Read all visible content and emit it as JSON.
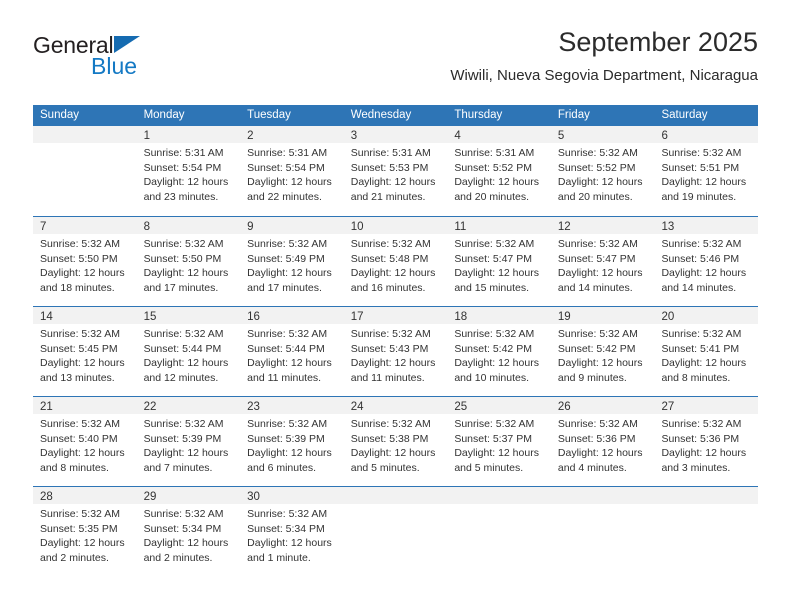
{
  "brand": {
    "name_part1": "General",
    "name_part2": "Blue",
    "triangle_color": "#156bb1",
    "blue_color": "#1479c4"
  },
  "header": {
    "title": "September 2025",
    "subtitle": "Wiwili, Nueva Segovia Department, Nicaragua"
  },
  "theme": {
    "header_blue": "#2e75b6",
    "daynum_band": "#f2f2f2",
    "text": "#333333"
  },
  "weekdays": [
    "Sunday",
    "Monday",
    "Tuesday",
    "Wednesday",
    "Thursday",
    "Friday",
    "Saturday"
  ],
  "weeks": [
    [
      {
        "day": "",
        "sunrise": "",
        "sunset": "",
        "daylight": "",
        "empty": true
      },
      {
        "day": "1",
        "sunrise": "Sunrise: 5:31 AM",
        "sunset": "Sunset: 5:54 PM",
        "daylight": "Daylight: 12 hours and 23 minutes."
      },
      {
        "day": "2",
        "sunrise": "Sunrise: 5:31 AM",
        "sunset": "Sunset: 5:54 PM",
        "daylight": "Daylight: 12 hours and 22 minutes."
      },
      {
        "day": "3",
        "sunrise": "Sunrise: 5:31 AM",
        "sunset": "Sunset: 5:53 PM",
        "daylight": "Daylight: 12 hours and 21 minutes."
      },
      {
        "day": "4",
        "sunrise": "Sunrise: 5:31 AM",
        "sunset": "Sunset: 5:52 PM",
        "daylight": "Daylight: 12 hours and 20 minutes."
      },
      {
        "day": "5",
        "sunrise": "Sunrise: 5:32 AM",
        "sunset": "Sunset: 5:52 PM",
        "daylight": "Daylight: 12 hours and 20 minutes."
      },
      {
        "day": "6",
        "sunrise": "Sunrise: 5:32 AM",
        "sunset": "Sunset: 5:51 PM",
        "daylight": "Daylight: 12 hours and 19 minutes."
      }
    ],
    [
      {
        "day": "7",
        "sunrise": "Sunrise: 5:32 AM",
        "sunset": "Sunset: 5:50 PM",
        "daylight": "Daylight: 12 hours and 18 minutes."
      },
      {
        "day": "8",
        "sunrise": "Sunrise: 5:32 AM",
        "sunset": "Sunset: 5:50 PM",
        "daylight": "Daylight: 12 hours and 17 minutes."
      },
      {
        "day": "9",
        "sunrise": "Sunrise: 5:32 AM",
        "sunset": "Sunset: 5:49 PM",
        "daylight": "Daylight: 12 hours and 17 minutes."
      },
      {
        "day": "10",
        "sunrise": "Sunrise: 5:32 AM",
        "sunset": "Sunset: 5:48 PM",
        "daylight": "Daylight: 12 hours and 16 minutes."
      },
      {
        "day": "11",
        "sunrise": "Sunrise: 5:32 AM",
        "sunset": "Sunset: 5:47 PM",
        "daylight": "Daylight: 12 hours and 15 minutes."
      },
      {
        "day": "12",
        "sunrise": "Sunrise: 5:32 AM",
        "sunset": "Sunset: 5:47 PM",
        "daylight": "Daylight: 12 hours and 14 minutes."
      },
      {
        "day": "13",
        "sunrise": "Sunrise: 5:32 AM",
        "sunset": "Sunset: 5:46 PM",
        "daylight": "Daylight: 12 hours and 14 minutes."
      }
    ],
    [
      {
        "day": "14",
        "sunrise": "Sunrise: 5:32 AM",
        "sunset": "Sunset: 5:45 PM",
        "daylight": "Daylight: 12 hours and 13 minutes."
      },
      {
        "day": "15",
        "sunrise": "Sunrise: 5:32 AM",
        "sunset": "Sunset: 5:44 PM",
        "daylight": "Daylight: 12 hours and 12 minutes."
      },
      {
        "day": "16",
        "sunrise": "Sunrise: 5:32 AM",
        "sunset": "Sunset: 5:44 PM",
        "daylight": "Daylight: 12 hours and 11 minutes."
      },
      {
        "day": "17",
        "sunrise": "Sunrise: 5:32 AM",
        "sunset": "Sunset: 5:43 PM",
        "daylight": "Daylight: 12 hours and 11 minutes."
      },
      {
        "day": "18",
        "sunrise": "Sunrise: 5:32 AM",
        "sunset": "Sunset: 5:42 PM",
        "daylight": "Daylight: 12 hours and 10 minutes."
      },
      {
        "day": "19",
        "sunrise": "Sunrise: 5:32 AM",
        "sunset": "Sunset: 5:42 PM",
        "daylight": "Daylight: 12 hours and 9 minutes."
      },
      {
        "day": "20",
        "sunrise": "Sunrise: 5:32 AM",
        "sunset": "Sunset: 5:41 PM",
        "daylight": "Daylight: 12 hours and 8 minutes."
      }
    ],
    [
      {
        "day": "21",
        "sunrise": "Sunrise: 5:32 AM",
        "sunset": "Sunset: 5:40 PM",
        "daylight": "Daylight: 12 hours and 8 minutes."
      },
      {
        "day": "22",
        "sunrise": "Sunrise: 5:32 AM",
        "sunset": "Sunset: 5:39 PM",
        "daylight": "Daylight: 12 hours and 7 minutes."
      },
      {
        "day": "23",
        "sunrise": "Sunrise: 5:32 AM",
        "sunset": "Sunset: 5:39 PM",
        "daylight": "Daylight: 12 hours and 6 minutes."
      },
      {
        "day": "24",
        "sunrise": "Sunrise: 5:32 AM",
        "sunset": "Sunset: 5:38 PM",
        "daylight": "Daylight: 12 hours and 5 minutes."
      },
      {
        "day": "25",
        "sunrise": "Sunrise: 5:32 AM",
        "sunset": "Sunset: 5:37 PM",
        "daylight": "Daylight: 12 hours and 5 minutes."
      },
      {
        "day": "26",
        "sunrise": "Sunrise: 5:32 AM",
        "sunset": "Sunset: 5:36 PM",
        "daylight": "Daylight: 12 hours and 4 minutes."
      },
      {
        "day": "27",
        "sunrise": "Sunrise: 5:32 AM",
        "sunset": "Sunset: 5:36 PM",
        "daylight": "Daylight: 12 hours and 3 minutes."
      }
    ],
    [
      {
        "day": "28",
        "sunrise": "Sunrise: 5:32 AM",
        "sunset": "Sunset: 5:35 PM",
        "daylight": "Daylight: 12 hours and 2 minutes."
      },
      {
        "day": "29",
        "sunrise": "Sunrise: 5:32 AM",
        "sunset": "Sunset: 5:34 PM",
        "daylight": "Daylight: 12 hours and 2 minutes."
      },
      {
        "day": "30",
        "sunrise": "Sunrise: 5:32 AM",
        "sunset": "Sunset: 5:34 PM",
        "daylight": "Daylight: 12 hours and 1 minute."
      },
      {
        "day": "",
        "sunrise": "",
        "sunset": "",
        "daylight": "",
        "empty": true
      },
      {
        "day": "",
        "sunrise": "",
        "sunset": "",
        "daylight": "",
        "empty": true
      },
      {
        "day": "",
        "sunrise": "",
        "sunset": "",
        "daylight": "",
        "empty": true
      },
      {
        "day": "",
        "sunrise": "",
        "sunset": "",
        "daylight": "",
        "empty": true
      }
    ]
  ]
}
